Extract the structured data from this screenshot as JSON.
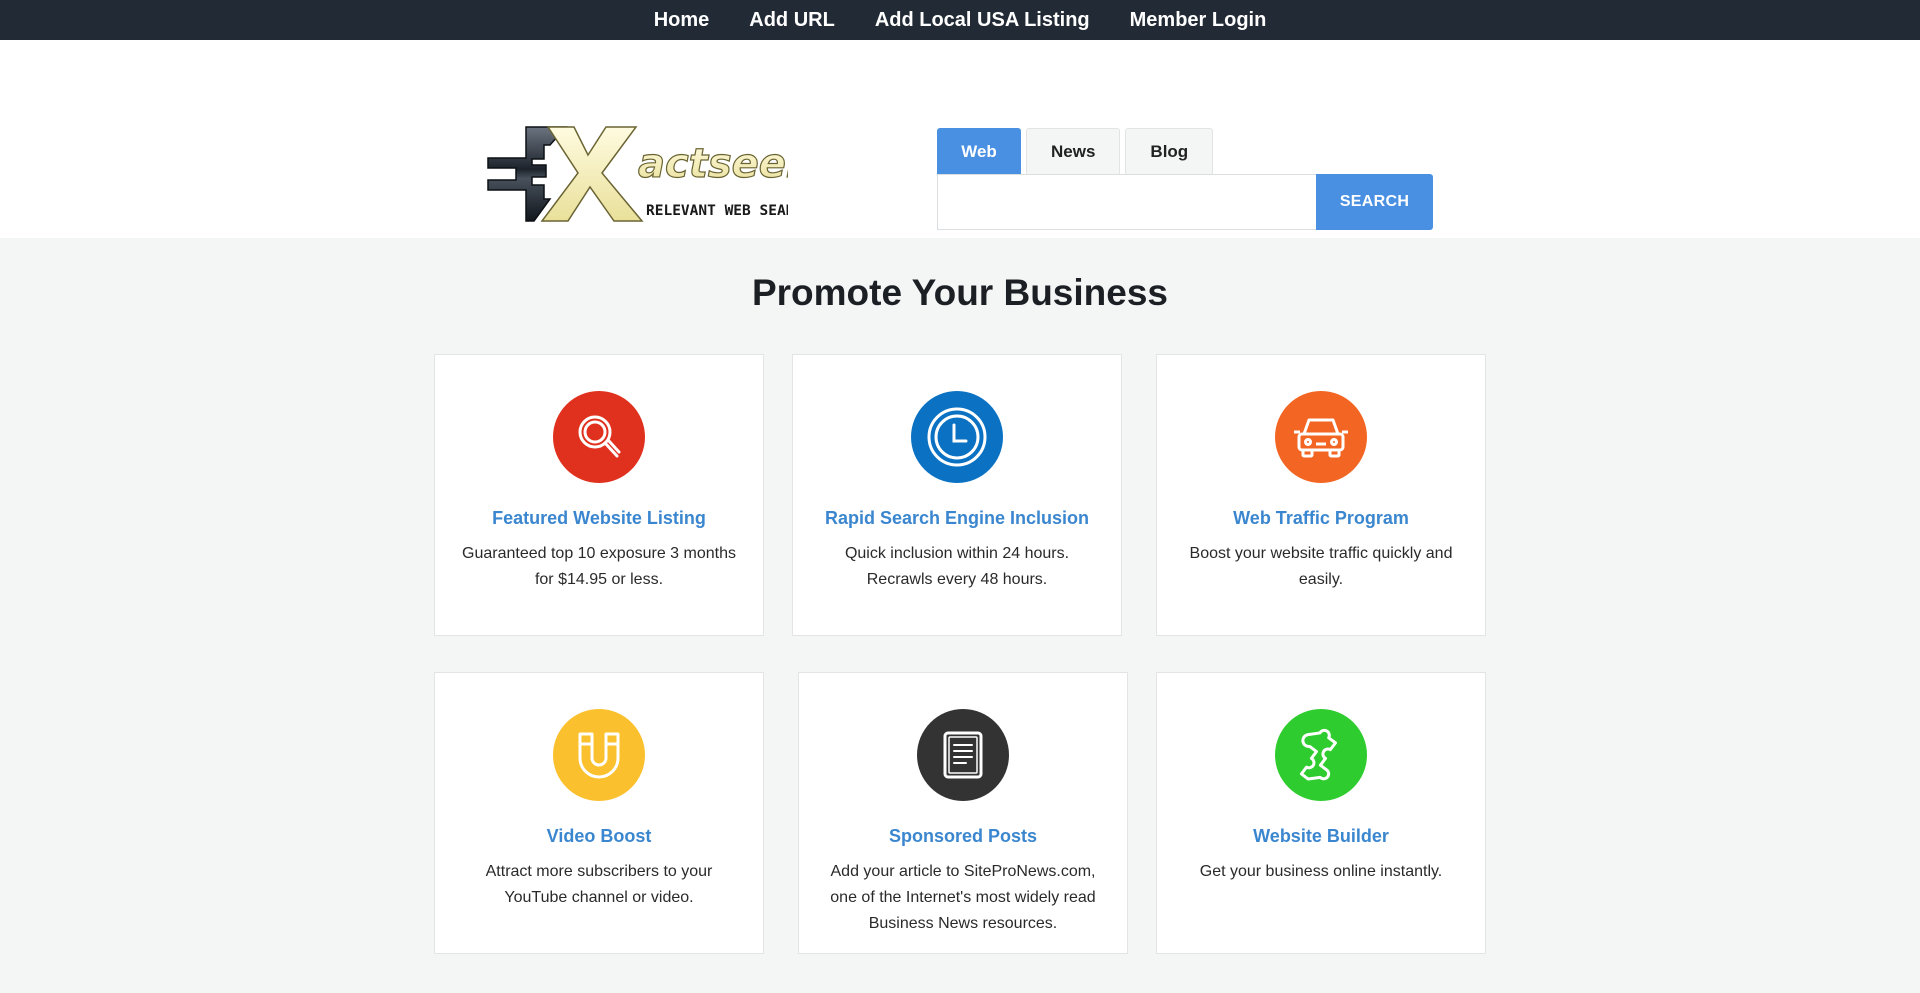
{
  "nav": {
    "items": [
      {
        "label": "Home"
      },
      {
        "label": "Add URL"
      },
      {
        "label": "Add Local USA Listing"
      },
      {
        "label": "Member Login"
      }
    ]
  },
  "logo": {
    "main_text": "actseek",
    "tagline": "RELEVANT WEB SEARCH"
  },
  "search": {
    "tabs": [
      {
        "label": "Web",
        "active": true
      },
      {
        "label": "News",
        "active": false
      },
      {
        "label": "Blog",
        "active": false
      }
    ],
    "input_value": "",
    "placeholder": "",
    "button_label": "SEARCH"
  },
  "main": {
    "title": "Promote Your Business",
    "cards": [
      {
        "title": "Featured Website Listing",
        "desc": "Guaranteed top 10 exposure 3 months for $14.95 or less.",
        "icon": "magnifier-icon",
        "color": "#e0301e"
      },
      {
        "title": "Rapid Search Engine Inclusion",
        "desc": "Quick inclusion within 24 hours. Recrawls every 48 hours.",
        "icon": "clock-icon",
        "color": "#0b72c3"
      },
      {
        "title": "Web Traffic Program",
        "desc": "Boost your website traffic quickly and easily.",
        "icon": "car-icon",
        "color": "#f26522"
      },
      {
        "title": "Video Boost",
        "desc": "Attract more subscribers to your YouTube channel or video.",
        "icon": "magnet-icon",
        "color": "#fbc02d"
      },
      {
        "title": "Sponsored Posts",
        "desc": "Add your article to SiteProNews.com, one of the Internet's most widely read Business News resources.",
        "icon": "document-icon",
        "color": "#333333"
      },
      {
        "title": "Website Builder",
        "desc": "Get your business online instantly.",
        "icon": "puzzle-icon",
        "color": "#2fcc2f"
      }
    ]
  },
  "colors": {
    "nav_bg": "#222a35",
    "accent": "#4a90e2",
    "link": "#3a86cf"
  }
}
